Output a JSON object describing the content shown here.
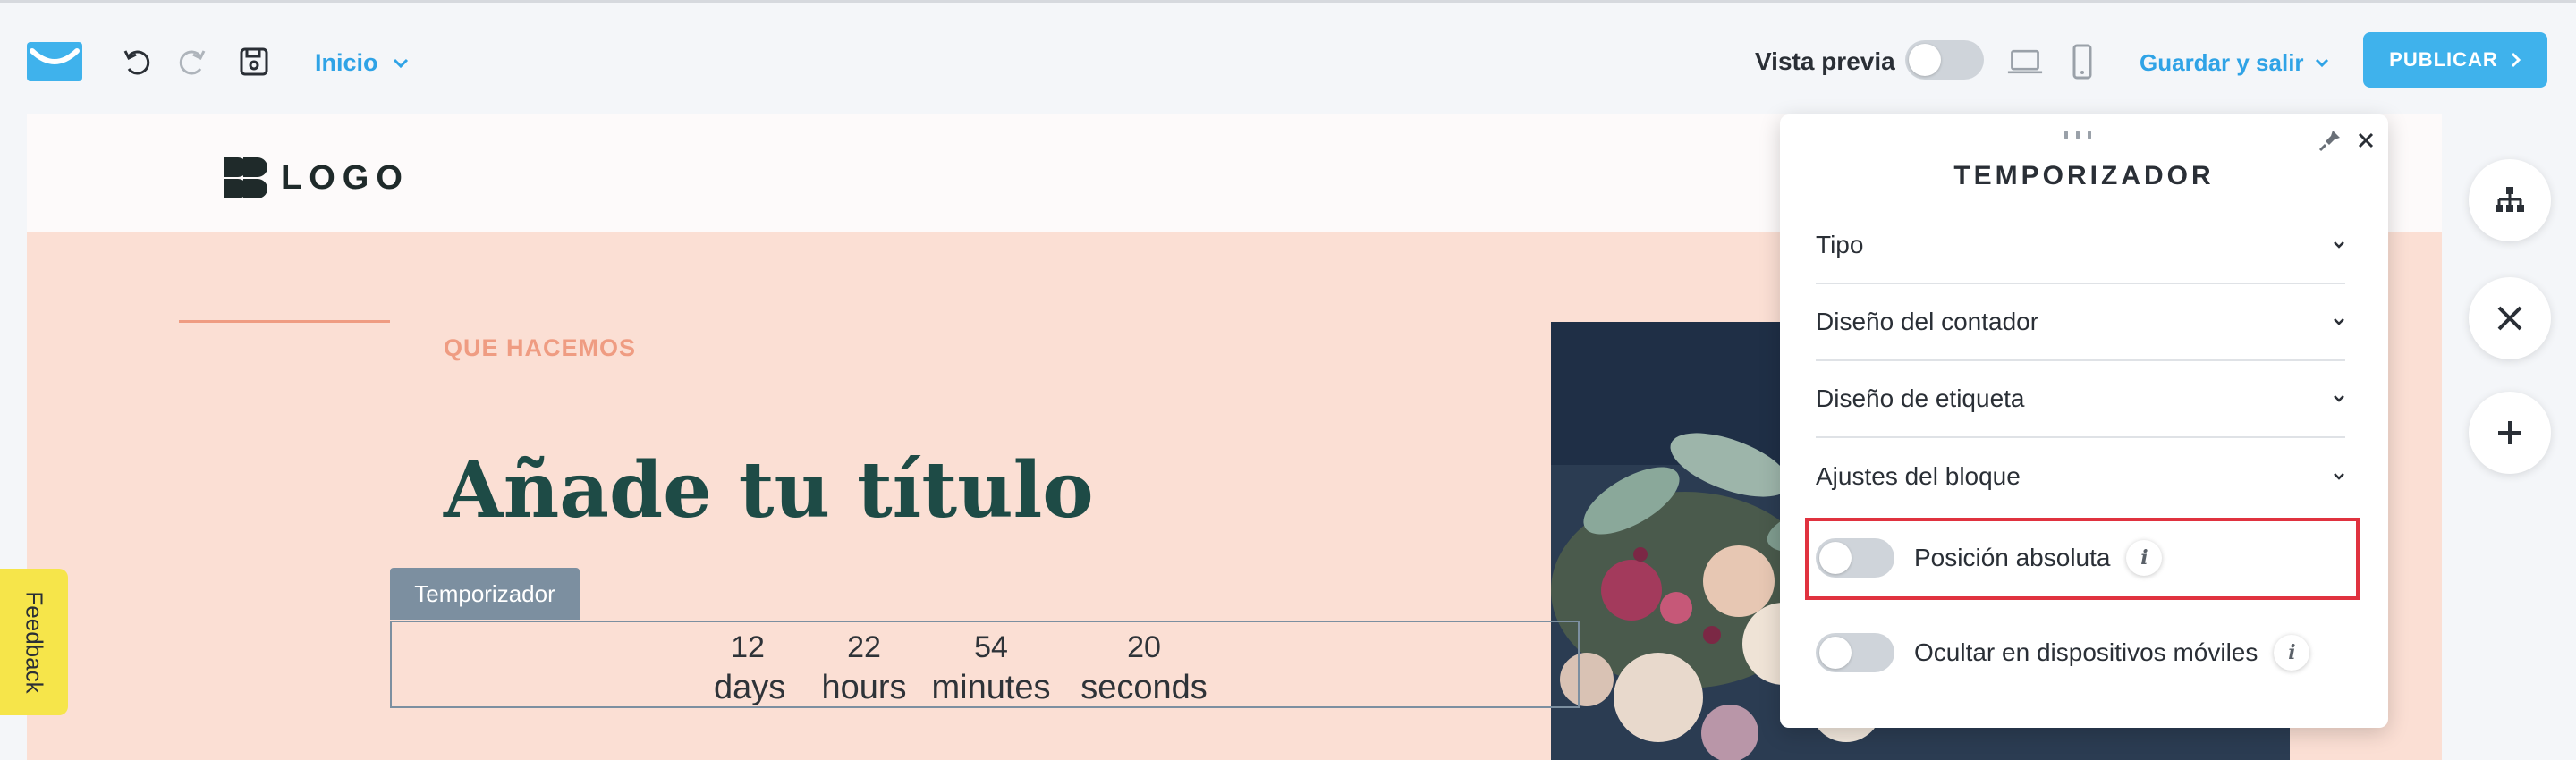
{
  "toolbar": {
    "page_selector": "Inicio",
    "preview_label": "Vista previa",
    "save_exit_label": "Guardar y salir",
    "publish_label": "PUBLICAR"
  },
  "canvas": {
    "logo_text": "LOGO",
    "kicker": "QUE HACEMOS",
    "headline": "Añade tu título",
    "timer": {
      "tab_label": "Temporizador",
      "units": [
        {
          "value": "12",
          "label": "days"
        },
        {
          "value": "22",
          "label": "hours"
        },
        {
          "value": "54",
          "label": "minutes"
        },
        {
          "value": "20",
          "label": "seconds"
        }
      ]
    }
  },
  "feedback_label": "Feedback",
  "panel": {
    "title": "TEMPORIZADOR",
    "sections": [
      {
        "label": "Tipo"
      },
      {
        "label": "Diseño del contador"
      },
      {
        "label": "Diseño de etiqueta"
      },
      {
        "label": "Ajustes del bloque"
      }
    ],
    "options": [
      {
        "label": "Posición absoluta",
        "enabled": false,
        "highlighted": true
      },
      {
        "label": "Ocultar en dispositivos móviles",
        "enabled": false,
        "highlighted": false
      }
    ]
  },
  "colors": {
    "accent_blue": "#3fb2ec",
    "canvas_bg": "#fbdfd4",
    "headline": "#1e4b46",
    "kicker": "#ef9c82",
    "highlight": "#e0323f"
  }
}
